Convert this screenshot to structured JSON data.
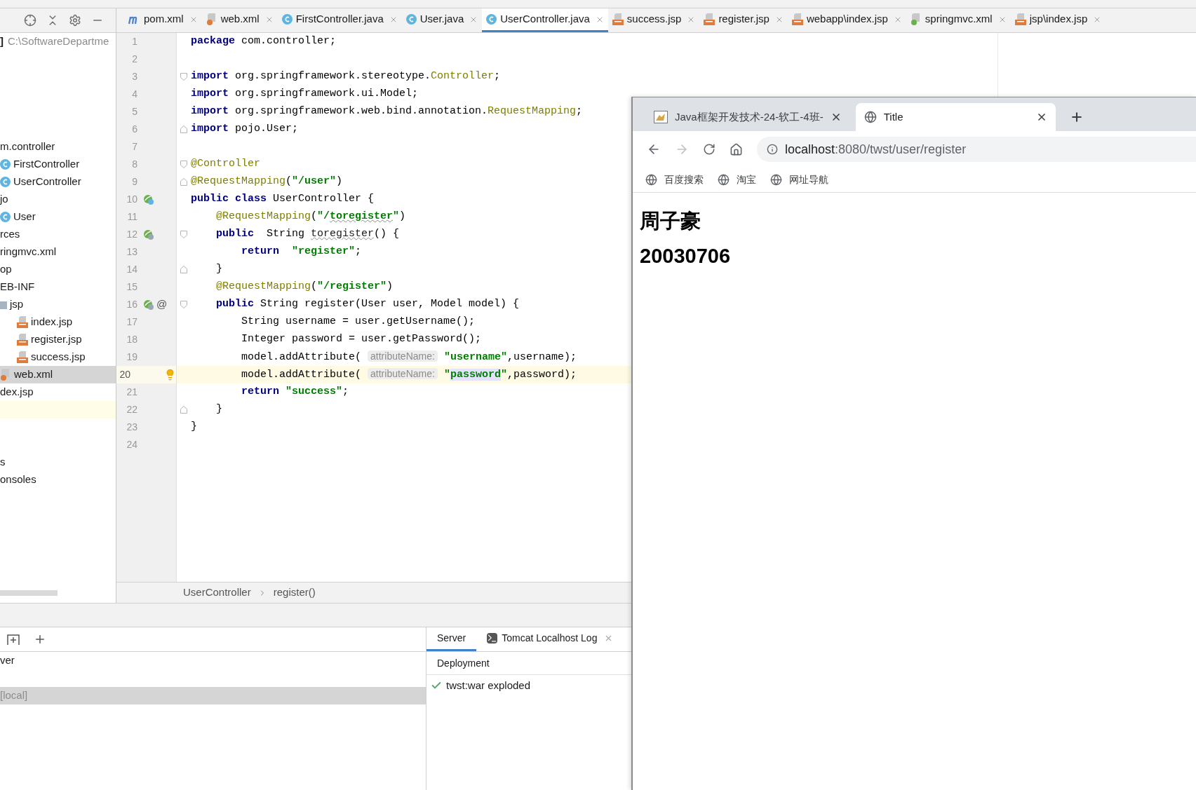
{
  "editor_tabs": [
    {
      "label": "pom.xml",
      "kind": "maven",
      "selected": false
    },
    {
      "label": "web.xml",
      "kind": "xml",
      "selected": false
    },
    {
      "label": "FirstController.java",
      "kind": "class",
      "selected": false
    },
    {
      "label": "User.java",
      "kind": "class",
      "selected": false
    },
    {
      "label": "UserController.java",
      "kind": "class",
      "selected": true
    },
    {
      "label": "success.jsp",
      "kind": "jsp",
      "selected": false
    },
    {
      "label": "register.jsp",
      "kind": "jsp",
      "selected": false
    },
    {
      "label": "webapp\\index.jsp",
      "kind": "jsp",
      "selected": false
    },
    {
      "label": "springmvc.xml",
      "kind": "spring",
      "selected": false
    },
    {
      "label": "jsp\\index.jsp",
      "kind": "jsp",
      "selected": false
    }
  ],
  "project_panel": {
    "bracket": "]",
    "path": "C:\\SoftwareDepartme",
    "tree": [
      {
        "label": "m.controller",
        "kind": "text",
        "selected": false
      },
      {
        "label": "FirstController",
        "kind": "class",
        "selected": false
      },
      {
        "label": "UserController",
        "kind": "class",
        "selected": false
      },
      {
        "label": "jo",
        "kind": "text",
        "selected": false
      },
      {
        "label": "User",
        "kind": "class",
        "selected": false
      },
      {
        "label": "rces",
        "kind": "text",
        "selected": false
      },
      {
        "label": "ringmvc.xml",
        "kind": "text",
        "selected": false
      },
      {
        "label": "op",
        "kind": "text",
        "selected": false
      },
      {
        "label": "EB-INF",
        "kind": "text",
        "selected": false
      },
      {
        "label": "jsp",
        "kind": "folder",
        "selected": false,
        "children": [
          {
            "label": "index.jsp",
            "kind": "jsp",
            "selected": false
          },
          {
            "label": "register.jsp",
            "kind": "jsp",
            "selected": false
          },
          {
            "label": "success.jsp",
            "kind": "jsp",
            "selected": false
          }
        ]
      },
      {
        "label": "web.xml",
        "kind": "xml",
        "selected": true
      },
      {
        "label": "dex.jsp",
        "kind": "text",
        "selected": false
      }
    ],
    "tree_bottom": [
      {
        "label": "s"
      },
      {
        "label": "onsoles"
      }
    ]
  },
  "code_lines": [
    {
      "number": "1",
      "current": false,
      "tokens": [
        {
          "kind": "kw",
          "text": "package"
        },
        {
          "kind": "plain",
          "text": " com.controller;"
        }
      ]
    },
    {
      "number": "2",
      "current": false
    },
    {
      "number": "3",
      "current": false,
      "fold": {
        "kind": "start"
      },
      "tokens": [
        {
          "kind": "kw",
          "text": "import"
        },
        {
          "kind": "plain",
          "text": " org.springframework.stereotype."
        },
        {
          "kind": "anno",
          "text": "Controller"
        },
        {
          "kind": "plain",
          "text": ";"
        }
      ]
    },
    {
      "number": "4",
      "current": false,
      "tokens": [
        {
          "kind": "kw",
          "text": "import"
        },
        {
          "kind": "plain",
          "text": " org.springframework.ui.Model;"
        }
      ]
    },
    {
      "number": "5",
      "current": false,
      "tokens": [
        {
          "kind": "kw",
          "text": "import"
        },
        {
          "kind": "plain",
          "text": " org.springframework.web.bind.annotation."
        },
        {
          "kind": "anno",
          "text": "RequestMapping"
        },
        {
          "kind": "plain",
          "text": ";"
        }
      ]
    },
    {
      "number": "6",
      "current": false,
      "fold": {
        "kind": "end"
      },
      "tokens": [
        {
          "kind": "kw",
          "text": "import"
        },
        {
          "kind": "plain",
          "text": " pojo.User;"
        }
      ]
    },
    {
      "number": "7",
      "current": false
    },
    {
      "number": "8",
      "current": false,
      "fold": {
        "kind": "start"
      },
      "tokens": [
        {
          "kind": "anno",
          "text": "@Controller"
        }
      ]
    },
    {
      "number": "9",
      "current": false,
      "fold": {
        "kind": "end"
      },
      "tokens": [
        {
          "kind": "anno",
          "text": "@RequestMapping"
        },
        {
          "kind": "plain",
          "text": "("
        },
        {
          "kind": "str",
          "text": "\"/user\""
        },
        {
          "kind": "plain",
          "text": ")"
        }
      ]
    },
    {
      "number": "10",
      "current": false,
      "gutter": [
        {
          "kind": "bean-class"
        }
      ],
      "tokens": [
        {
          "kind": "kw",
          "text": "public class"
        },
        {
          "kind": "plain",
          "text": " UserController {"
        }
      ]
    },
    {
      "number": "11",
      "current": false,
      "tokens": [
        {
          "kind": "anno",
          "text": "    @RequestMapping"
        },
        {
          "kind": "plain",
          "text": "("
        },
        {
          "kind": "str",
          "text": "\"/"
        },
        {
          "kind": "str_warn",
          "text": "toregister"
        },
        {
          "kind": "str",
          "text": "\""
        },
        {
          "kind": "plain",
          "text": ")"
        }
      ]
    },
    {
      "number": "12",
      "current": false,
      "gutter": [
        {
          "kind": "bean-method"
        }
      ],
      "fold": {
        "kind": "start"
      },
      "tokens": [
        {
          "kind": "kw",
          "text": "    public"
        },
        {
          "kind": "plain",
          "text": "  String "
        },
        {
          "kind": "warn",
          "text": "toregister"
        },
        {
          "kind": "plain",
          "text": "() {"
        }
      ]
    },
    {
      "number": "13",
      "current": false,
      "tokens": [
        {
          "kind": "kw",
          "text": "        return"
        },
        {
          "kind": "str",
          "text": "  \"register\""
        },
        {
          "kind": "plain",
          "text": ";"
        }
      ]
    },
    {
      "number": "14",
      "current": false,
      "fold": {
        "kind": "end"
      },
      "tokens": [
        {
          "kind": "plain",
          "text": "    }"
        }
      ]
    },
    {
      "number": "15",
      "current": false,
      "tokens": [
        {
          "kind": "anno",
          "text": "    @RequestMapping"
        },
        {
          "kind": "plain",
          "text": "("
        },
        {
          "kind": "str",
          "text": "\"/register\""
        },
        {
          "kind": "plain",
          "text": ")"
        }
      ]
    },
    {
      "number": "16",
      "current": false,
      "gutter": [
        {
          "kind": "bean-method"
        },
        {
          "kind": "implementation",
          "text": "@"
        }
      ],
      "fold": {
        "kind": "start"
      },
      "tokens": [
        {
          "kind": "kw",
          "text": "    public"
        },
        {
          "kind": "plain",
          "text": " String register(User user, Model model) {"
        }
      ]
    },
    {
      "number": "17",
      "current": false,
      "tokens": [
        {
          "kind": "plain",
          "text": "        String username = user.getUsername();"
        }
      ]
    },
    {
      "number": "18",
      "current": false,
      "tokens": [
        {
          "kind": "plain",
          "text": "        Integer password = user.getPassword();"
        }
      ]
    },
    {
      "number": "19",
      "current": false,
      "tokens": [
        {
          "kind": "plain",
          "text": "        model.addAttribute( "
        },
        {
          "kind": "hint",
          "text": "attributeName:"
        },
        {
          "kind": "str",
          "text": " \"username\""
        },
        {
          "kind": "plain",
          "text": ",username);"
        }
      ]
    },
    {
      "number": "20",
      "current": true,
      "gutter": [
        {
          "kind": "bulb"
        }
      ],
      "tokens": [
        {
          "kind": "plain",
          "text": "        model.addAttribute( "
        },
        {
          "kind": "hint",
          "text": "attributeName:"
        },
        {
          "kind": "str",
          "text": " \""
        },
        {
          "kind": "str_marked",
          "text": "password"
        },
        {
          "kind": "str",
          "text": "\""
        },
        {
          "kind": "plain",
          "text": ",password);"
        }
      ]
    },
    {
      "number": "21",
      "current": false,
      "tokens": [
        {
          "kind": "kw",
          "text": "        return"
        },
        {
          "kind": "str",
          "text": " \"success\""
        },
        {
          "kind": "plain",
          "text": ";"
        }
      ]
    },
    {
      "number": "22",
      "current": false,
      "fold": {
        "kind": "end"
      },
      "tokens": [
        {
          "kind": "plain",
          "text": "    }"
        }
      ]
    },
    {
      "number": "23",
      "current": false,
      "tokens": [
        {
          "kind": "plain",
          "text": "}"
        }
      ]
    },
    {
      "number": "24",
      "current": false
    }
  ],
  "breadcrumb": [
    "UserController",
    "register()"
  ],
  "services": {
    "rows": [
      {
        "label": "ver",
        "selected": false
      },
      {
        "label": "[local]",
        "selected": true
      }
    ],
    "tabs": [
      {
        "label": "Server",
        "selected": true,
        "closable": false,
        "kind": "plain"
      },
      {
        "label": "Tomcat Localhost Log",
        "selected": false,
        "closable": true,
        "kind": "log"
      }
    ],
    "header": "Deployment",
    "deployments": [
      {
        "label": "twst:war exploded",
        "kind": "deployed"
      }
    ]
  },
  "browser": {
    "tabs": [
      {
        "label": "Java框架开发技术-24-软工-4班-",
        "kind": "site",
        "selected": false
      },
      {
        "label": "Title",
        "kind": "globe",
        "selected": true
      }
    ],
    "url_host": "localhost",
    "url_path": ":8080/twst/user/register",
    "bookmarks": [
      {
        "label": "百度搜索"
      },
      {
        "label": "淘宝"
      },
      {
        "label": "网址导航"
      }
    ],
    "headings": [
      "周子豪",
      "20030706"
    ]
  }
}
